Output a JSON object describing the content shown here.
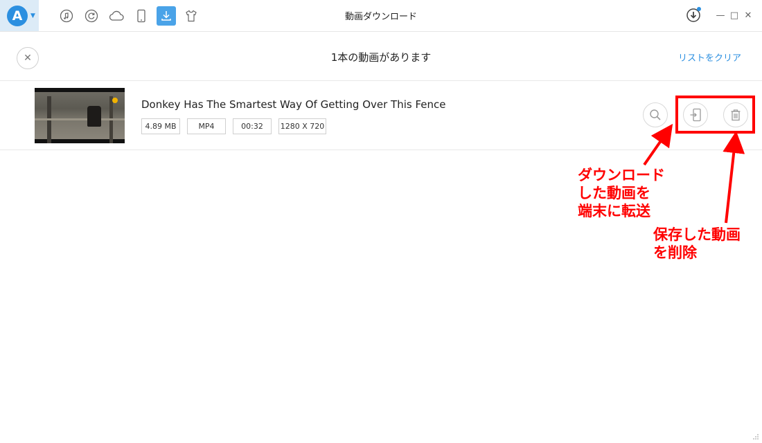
{
  "window": {
    "title": "動画ダウンロード",
    "controls": {
      "minimize": "—",
      "maximize": "□",
      "close": "✕"
    }
  },
  "nav": {
    "logo_letter": "A",
    "icons": [
      "music-icon",
      "backup-restore-icon",
      "cloud-icon",
      "device-icon",
      "download-icon",
      "tshirt-icon"
    ],
    "active": "download-icon"
  },
  "header": {
    "title": "1本の動画があります",
    "clear_label": "リストをクリア",
    "close_label": "✕"
  },
  "video": {
    "title": "Donkey Has The Smartest Way Of Getting Over This Fence",
    "size": "4.89 MB",
    "format": "MP4",
    "duration": "00:32",
    "resolution": "1280 X 720"
  },
  "annotations": {
    "transfer": [
      "ダウンロード",
      "した動画を",
      "端末に転送"
    ],
    "delete": [
      "保存した動画",
      "を削除"
    ]
  },
  "colors": {
    "accent": "#2b8fe0",
    "annotation": "#ff0000",
    "border": "#e6e6e6"
  }
}
